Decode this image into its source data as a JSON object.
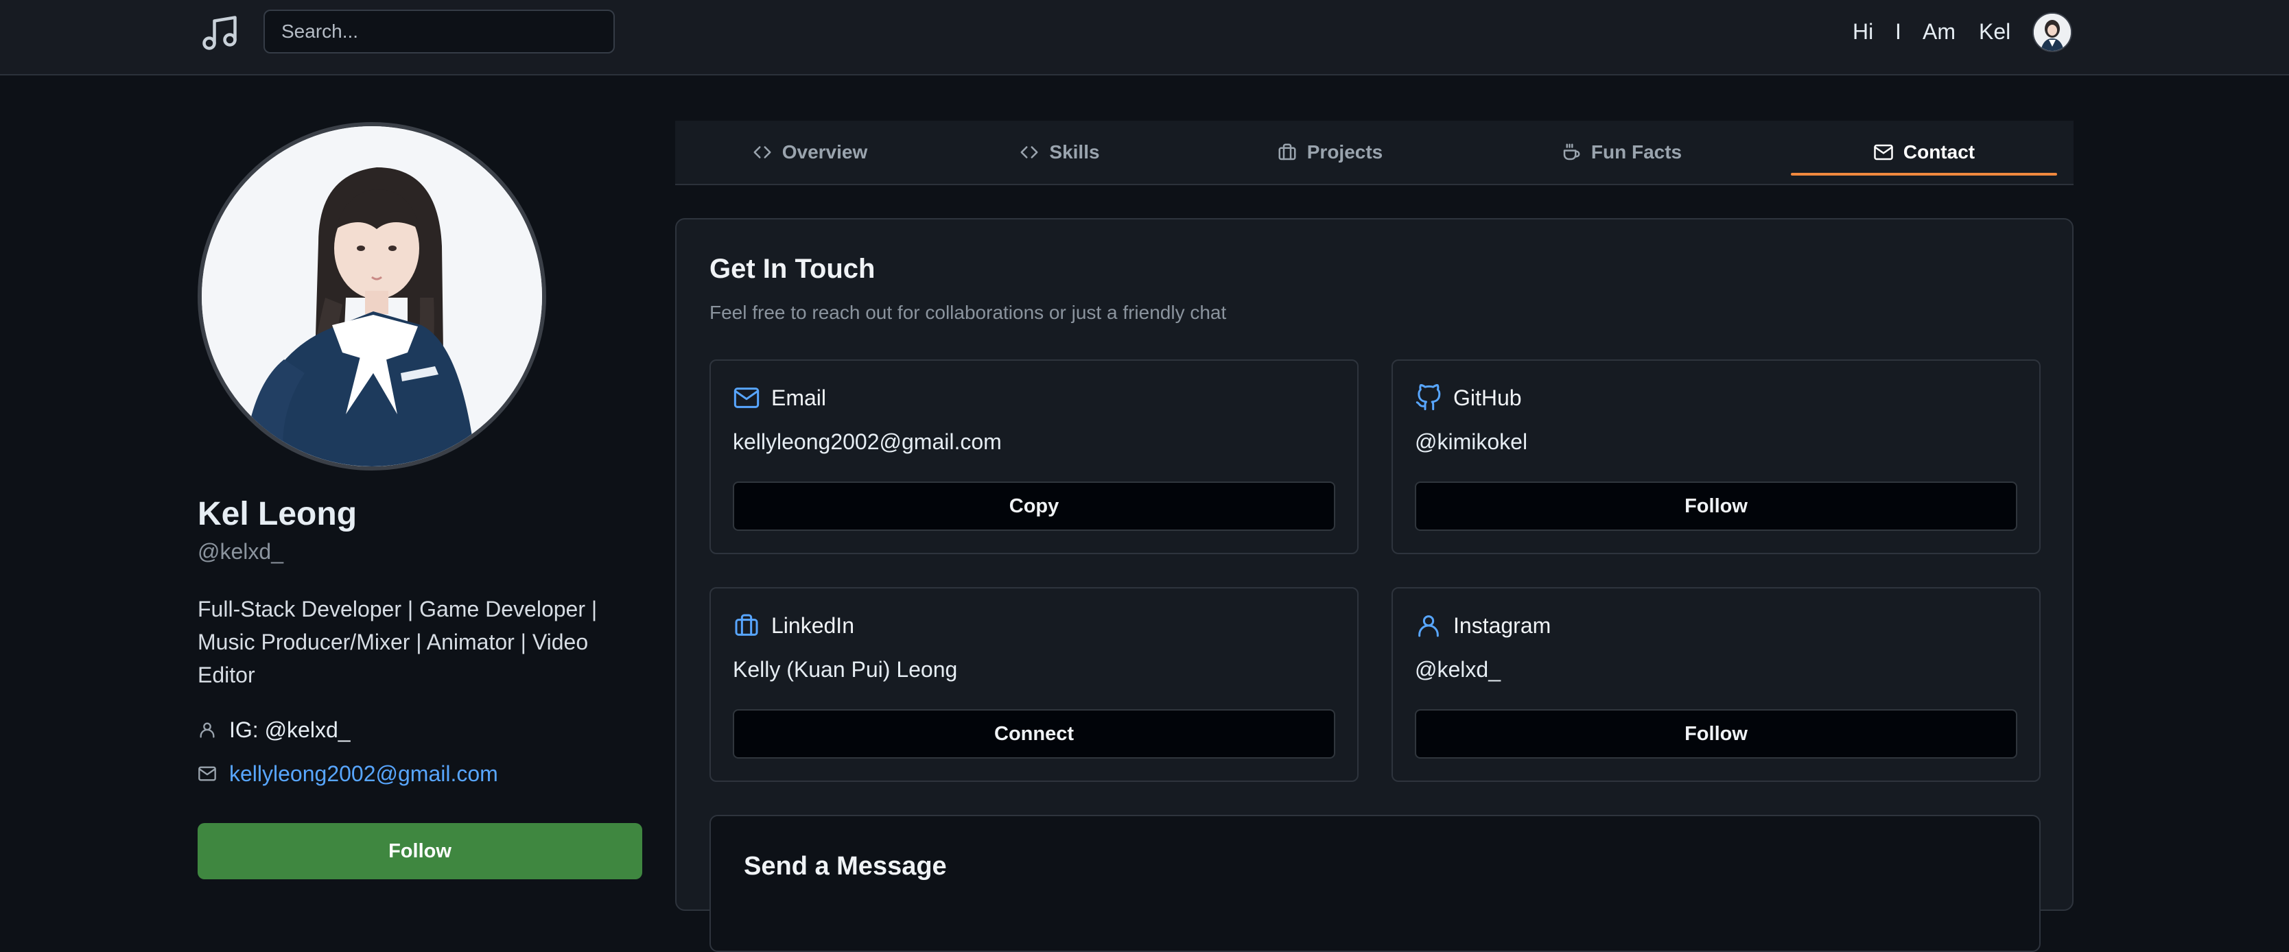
{
  "navbar": {
    "logo_icon": "music-note-icon",
    "search_placeholder": "Search...",
    "greeting": [
      "Hi",
      "I",
      "Am",
      "Kel"
    ]
  },
  "profile": {
    "name": "Kel Leong",
    "handle": "@kelxd_",
    "bio": "Full-Stack Developer | Game Developer | Music Producer/Mixer | Animator | Video Editor",
    "instagram": "IG: @kelxd_",
    "email": "kellyleong2002@gmail.com",
    "follow_label": "Follow",
    "follow_color": "#3f8740"
  },
  "tabs": [
    {
      "label": "Overview",
      "icon": "code-icon"
    },
    {
      "label": "Skills",
      "icon": "code-icon"
    },
    {
      "label": "Projects",
      "icon": "briefcase-icon"
    },
    {
      "label": "Fun Facts",
      "icon": "coffee-icon"
    },
    {
      "label": "Contact",
      "icon": "mail-icon",
      "active": true
    }
  ],
  "contact_section": {
    "title": "Get In Touch",
    "subtitle": "Feel free to reach out for collaborations or just a friendly chat",
    "cards": [
      {
        "name": "Email",
        "icon": "mail-icon",
        "value": "kellyleong2002@gmail.com",
        "button": "Copy"
      },
      {
        "name": "GitHub",
        "icon": "github-icon",
        "value": "@kimikokel",
        "button": "Follow"
      },
      {
        "name": "LinkedIn",
        "icon": "briefcase-icon",
        "value": "Kelly (Kuan Pui) Leong",
        "button": "Connect"
      },
      {
        "name": "Instagram",
        "icon": "user-icon",
        "value": "@kelxd_",
        "button": "Follow"
      }
    ],
    "message_title": "Send a Message"
  },
  "colors": {
    "accent_underline": "#f0883e",
    "icon_blue": "#58a6ff",
    "link_blue": "#58a6ff"
  }
}
